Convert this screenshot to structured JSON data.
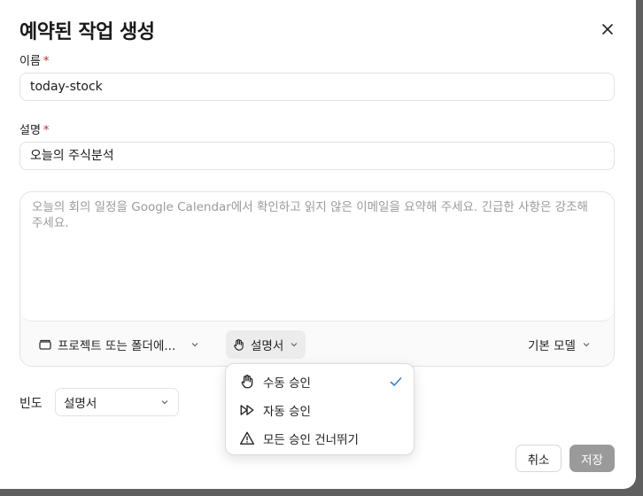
{
  "dialog": {
    "title": "예약된 작업 생성",
    "close_icon": "close-icon"
  },
  "name_field": {
    "label": "이름",
    "required_mark": "*",
    "value": "today-stock"
  },
  "description_field": {
    "label": "설명",
    "required_mark": "*",
    "value": "오늘의 주식분석"
  },
  "prompt": {
    "placeholder": "오늘의 회의 일정을 Google Calendar에서 확인하고 읽지 않은 이메일을 요약해 주세요. 긴급한 사항은 강조해 주세요.",
    "toolbar": {
      "folder_label": "프로젝트 또는 폴더에...",
      "approval_label": "설명서",
      "model_label": "기본 모델"
    }
  },
  "approval_menu": {
    "items": [
      {
        "label": "수동 승인",
        "icon": "hand-icon",
        "selected": true
      },
      {
        "label": "자동 승인",
        "icon": "fast-forward-icon",
        "selected": false
      },
      {
        "label": "모든 승인 건너뛰기",
        "icon": "warning-triangle-icon",
        "selected": false
      }
    ],
    "check_color": "#3b7dd8"
  },
  "frequency": {
    "label": "빈도",
    "value": "설명서"
  },
  "buttons": {
    "cancel": "취소",
    "save": "저장"
  }
}
